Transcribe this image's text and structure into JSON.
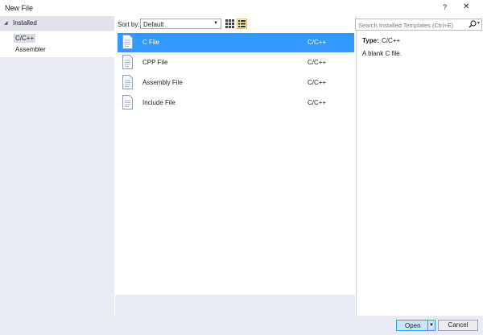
{
  "window": {
    "title": "New File",
    "help_label": "?",
    "close_label": "✕"
  },
  "left_panel": {
    "section_label": "Installed",
    "items": [
      {
        "label": "C/C++",
        "selected": true
      },
      {
        "label": "Assembler",
        "selected": false
      }
    ]
  },
  "toolbar": {
    "sort_label": "Sort by:",
    "sort_value": "Default"
  },
  "templates": [
    {
      "name": "C File",
      "language": "C/C++",
      "selected": true
    },
    {
      "name": "CPP File",
      "language": "C/C++",
      "selected": false
    },
    {
      "name": "Assembly File",
      "language": "C/C++",
      "selected": false
    },
    {
      "name": "Include File",
      "language": "C/C++",
      "selected": false
    }
  ],
  "search": {
    "placeholder": "Search Installed Templates (Ctrl+E)"
  },
  "details": {
    "type_label": "Type:",
    "type_value": "C/C++",
    "description": "A blank C file."
  },
  "buttons": {
    "open_label": "Open",
    "cancel_label": "Cancel"
  },
  "colors": {
    "selection": "#3399ff",
    "panel": "#e8ebf4",
    "button_focus": "#cce4f7"
  }
}
